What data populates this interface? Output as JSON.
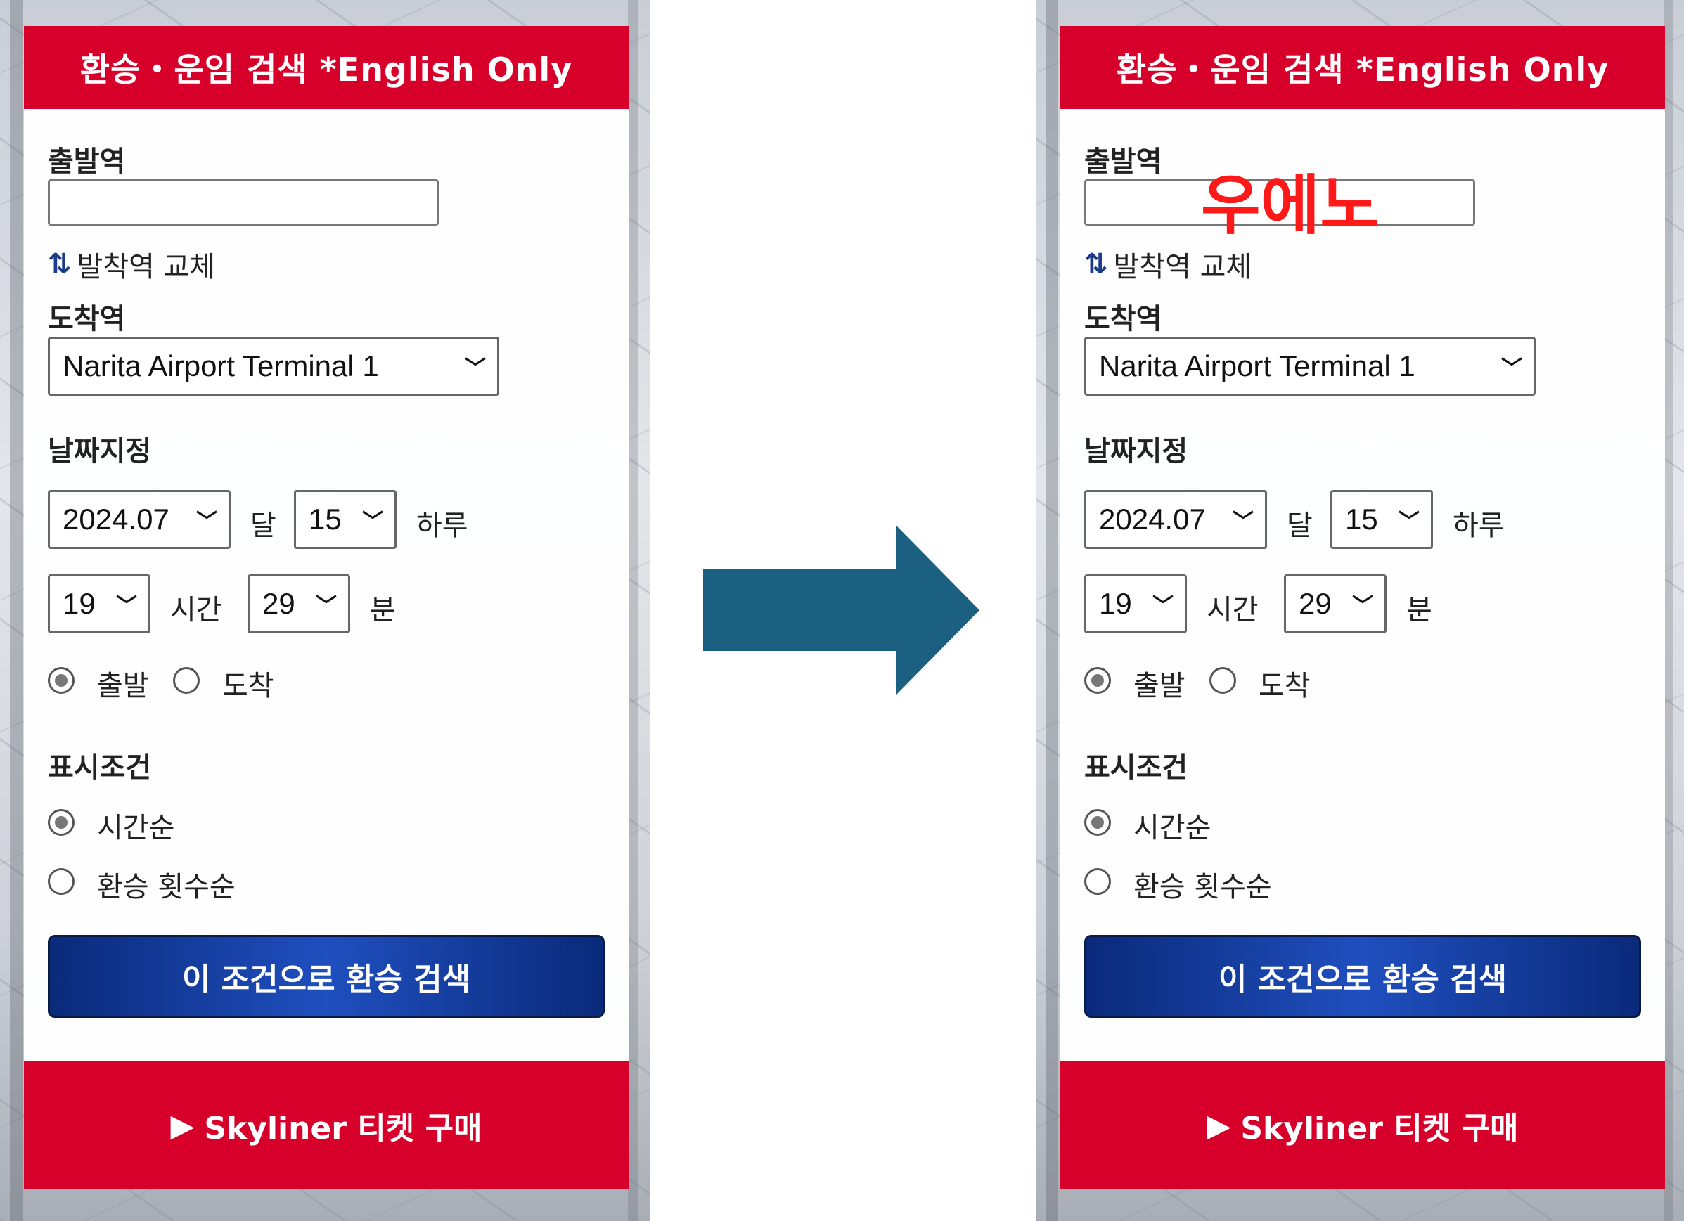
{
  "panel": {
    "header_title": "환승・운임 검색 *English Only",
    "departure_label": "출발역",
    "departure_value": "",
    "swap_icon": "swap-arrows-icon",
    "swap_label": "발착역 교체",
    "arrival_label": "도착역",
    "arrival_selected": "Narita Airport Terminal 1",
    "date_label": "날짜지정",
    "year_month": "2024.07",
    "month_unit": "달",
    "day": "15",
    "day_unit": "하루",
    "hour": "19",
    "hour_unit": "시간",
    "minute": "29",
    "minute_unit": "분",
    "depart_option": "출발",
    "arrive_option": "도착",
    "display_label": "표시조건",
    "sort_time": "시간순",
    "sort_transfers": "환승 횟수순",
    "search_button": "이 조건으로 환승 검색",
    "footer_link": "Skyliner 티켓 구매"
  },
  "annotation": {
    "text": "우에노",
    "color": "#ff1a1a"
  },
  "colors": {
    "brand_red": "#d6002a",
    "button_blue": "#0a2a7a",
    "arrow_teal": "#1b6080"
  }
}
